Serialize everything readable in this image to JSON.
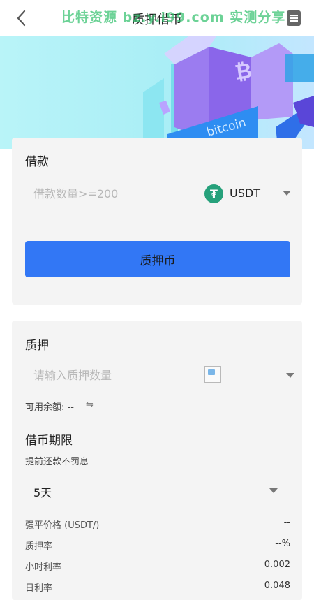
{
  "header": {
    "title": "质押借币",
    "watermark": "比特资源 bz.y.i99.com 实测分享",
    "back_icon": "chevron-left-icon",
    "menu_icon": "document-menu-icon"
  },
  "banner": {
    "image_text": "bitcoin",
    "symbol": "₿"
  },
  "borrow": {
    "title": "借款",
    "amount_placeholder": "借款数量>=200",
    "amount_value": "",
    "coin": "USDT",
    "coin_icon": "usdt-icon",
    "coin_glyph": "₮",
    "submit_label": "质押币"
  },
  "collateral": {
    "title": "质押",
    "amount_placeholder": "请输入质押数量",
    "amount_value": "",
    "available_label": "可用余额: --",
    "swap_icon": "⇋",
    "period_title": "借币期限",
    "period_note": "提前还款不罚息",
    "period_value": "5天",
    "info": [
      {
        "label": "强平价格 (USDT/)",
        "value": "--"
      },
      {
        "label": "质押率",
        "value": "--%"
      },
      {
        "label": "小时利率",
        "value": "0.002"
      },
      {
        "label": "日利率",
        "value": "0.048"
      }
    ]
  },
  "colors": {
    "primary_button": "#3277f5",
    "card_background": "#f4f4f4",
    "usdt_green": "#26a17b",
    "watermark_green": "#2fbf6b",
    "banner_cyan": "#b9f4f8"
  }
}
